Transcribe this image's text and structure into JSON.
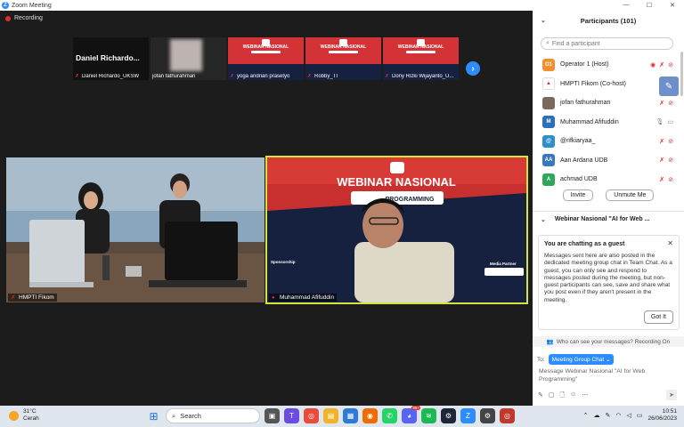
{
  "window": {
    "title": "Zoom Meeting",
    "controls": [
      "—",
      "☐",
      "✕"
    ]
  },
  "meeting": {
    "recording_label": "Recording",
    "thumbnails": [
      {
        "name": "Daniel Richardo_UKSW",
        "display": "Daniel  Richardo...",
        "style": "black"
      },
      {
        "name": "jofan fathurahman",
        "style": "blur"
      },
      {
        "name": "yoga andrian prasetyo",
        "style": "web",
        "banner": "WEBINAR NASIONAL"
      },
      {
        "name": "Robby_TI",
        "style": "web",
        "banner": "WEBINAR NASIONAL"
      },
      {
        "name": "Dony Rizki Wijayanto_U...",
        "style": "web",
        "banner": "WEBINAR NASIONAL"
      }
    ],
    "next_icon": "›",
    "tiles": [
      {
        "name": "HMPTI Fikom"
      },
      {
        "name": "Muhammad Afifuddin",
        "banner_title": "WEBINAR NASIONAL",
        "banner_sub": "PROGRAMMING",
        "sponsor_label": "Sponsorship",
        "media_label": "Media Partner"
      }
    ]
  },
  "participants": {
    "title": "Participants (101)",
    "search_placeholder": "Find a participant",
    "list": [
      {
        "initials": "O1",
        "name": "Operator 1 (Host)",
        "color": "#f2912b"
      },
      {
        "initials": "▲",
        "name": "HMPTI Fikom (Co-host)",
        "color": "#ffffff"
      },
      {
        "initials": "",
        "name": "jofan fathurahman",
        "color": "#7a6a5e"
      },
      {
        "initials": "M",
        "name": "Muhammad Afifuddin",
        "color": "#2d6fb8"
      },
      {
        "initials": "@",
        "name": "@rifkiaryaa_",
        "color": "#2f8fc9"
      },
      {
        "initials": "AA",
        "name": "Aan Ardana UDB",
        "color": "#3a79c2"
      },
      {
        "initials": "A",
        "name": "achmad UDB",
        "color": "#2fa65a"
      }
    ],
    "invite_label": "Invite",
    "unmute_label": "Unmute Me"
  },
  "chat": {
    "title": "Webinar Nasional \"AI for Web ...",
    "guest_title": "You are chatting as a guest",
    "guest_body": "Messages sent here are also posted in the dedicated meeting group chat in Team Chat. As a guest, you can only see and respond to messages posted during the meeting, but non-guest participants can see, save and share what you post even if they aren't present in the meeting.",
    "got_it": "Got It",
    "who_can_see": "Who can see your messages? Recording On",
    "to_label": "To:",
    "to_value": "Meeting Group Chat ⌄",
    "input_placeholder": "Message Webinar Nasional \"AI for Web Programming\""
  },
  "taskbar": {
    "temperature": "31°C",
    "weather": "Cerah",
    "search_label": "Search",
    "time": "10:51",
    "date": "26/06/2023",
    "badge": "99+"
  }
}
